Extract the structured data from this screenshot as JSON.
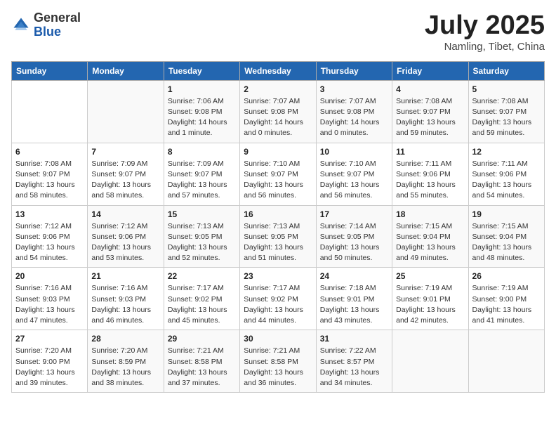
{
  "header": {
    "logo_general": "General",
    "logo_blue": "Blue",
    "month_title": "July 2025",
    "location": "Namling, Tibet, China"
  },
  "weekdays": [
    "Sunday",
    "Monday",
    "Tuesday",
    "Wednesday",
    "Thursday",
    "Friday",
    "Saturday"
  ],
  "weeks": [
    [
      {
        "day": "",
        "info": ""
      },
      {
        "day": "",
        "info": ""
      },
      {
        "day": "1",
        "info": "Sunrise: 7:06 AM\nSunset: 9:08 PM\nDaylight: 14 hours and 1 minute."
      },
      {
        "day": "2",
        "info": "Sunrise: 7:07 AM\nSunset: 9:08 PM\nDaylight: 14 hours and 0 minutes."
      },
      {
        "day": "3",
        "info": "Sunrise: 7:07 AM\nSunset: 9:08 PM\nDaylight: 14 hours and 0 minutes."
      },
      {
        "day": "4",
        "info": "Sunrise: 7:08 AM\nSunset: 9:07 PM\nDaylight: 13 hours and 59 minutes."
      },
      {
        "day": "5",
        "info": "Sunrise: 7:08 AM\nSunset: 9:07 PM\nDaylight: 13 hours and 59 minutes."
      }
    ],
    [
      {
        "day": "6",
        "info": "Sunrise: 7:08 AM\nSunset: 9:07 PM\nDaylight: 13 hours and 58 minutes."
      },
      {
        "day": "7",
        "info": "Sunrise: 7:09 AM\nSunset: 9:07 PM\nDaylight: 13 hours and 58 minutes."
      },
      {
        "day": "8",
        "info": "Sunrise: 7:09 AM\nSunset: 9:07 PM\nDaylight: 13 hours and 57 minutes."
      },
      {
        "day": "9",
        "info": "Sunrise: 7:10 AM\nSunset: 9:07 PM\nDaylight: 13 hours and 56 minutes."
      },
      {
        "day": "10",
        "info": "Sunrise: 7:10 AM\nSunset: 9:07 PM\nDaylight: 13 hours and 56 minutes."
      },
      {
        "day": "11",
        "info": "Sunrise: 7:11 AM\nSunset: 9:06 PM\nDaylight: 13 hours and 55 minutes."
      },
      {
        "day": "12",
        "info": "Sunrise: 7:11 AM\nSunset: 9:06 PM\nDaylight: 13 hours and 54 minutes."
      }
    ],
    [
      {
        "day": "13",
        "info": "Sunrise: 7:12 AM\nSunset: 9:06 PM\nDaylight: 13 hours and 54 minutes."
      },
      {
        "day": "14",
        "info": "Sunrise: 7:12 AM\nSunset: 9:06 PM\nDaylight: 13 hours and 53 minutes."
      },
      {
        "day": "15",
        "info": "Sunrise: 7:13 AM\nSunset: 9:05 PM\nDaylight: 13 hours and 52 minutes."
      },
      {
        "day": "16",
        "info": "Sunrise: 7:13 AM\nSunset: 9:05 PM\nDaylight: 13 hours and 51 minutes."
      },
      {
        "day": "17",
        "info": "Sunrise: 7:14 AM\nSunset: 9:05 PM\nDaylight: 13 hours and 50 minutes."
      },
      {
        "day": "18",
        "info": "Sunrise: 7:15 AM\nSunset: 9:04 PM\nDaylight: 13 hours and 49 minutes."
      },
      {
        "day": "19",
        "info": "Sunrise: 7:15 AM\nSunset: 9:04 PM\nDaylight: 13 hours and 48 minutes."
      }
    ],
    [
      {
        "day": "20",
        "info": "Sunrise: 7:16 AM\nSunset: 9:03 PM\nDaylight: 13 hours and 47 minutes."
      },
      {
        "day": "21",
        "info": "Sunrise: 7:16 AM\nSunset: 9:03 PM\nDaylight: 13 hours and 46 minutes."
      },
      {
        "day": "22",
        "info": "Sunrise: 7:17 AM\nSunset: 9:02 PM\nDaylight: 13 hours and 45 minutes."
      },
      {
        "day": "23",
        "info": "Sunrise: 7:17 AM\nSunset: 9:02 PM\nDaylight: 13 hours and 44 minutes."
      },
      {
        "day": "24",
        "info": "Sunrise: 7:18 AM\nSunset: 9:01 PM\nDaylight: 13 hours and 43 minutes."
      },
      {
        "day": "25",
        "info": "Sunrise: 7:19 AM\nSunset: 9:01 PM\nDaylight: 13 hours and 42 minutes."
      },
      {
        "day": "26",
        "info": "Sunrise: 7:19 AM\nSunset: 9:00 PM\nDaylight: 13 hours and 41 minutes."
      }
    ],
    [
      {
        "day": "27",
        "info": "Sunrise: 7:20 AM\nSunset: 9:00 PM\nDaylight: 13 hours and 39 minutes."
      },
      {
        "day": "28",
        "info": "Sunrise: 7:20 AM\nSunset: 8:59 PM\nDaylight: 13 hours and 38 minutes."
      },
      {
        "day": "29",
        "info": "Sunrise: 7:21 AM\nSunset: 8:58 PM\nDaylight: 13 hours and 37 minutes."
      },
      {
        "day": "30",
        "info": "Sunrise: 7:21 AM\nSunset: 8:58 PM\nDaylight: 13 hours and 36 minutes."
      },
      {
        "day": "31",
        "info": "Sunrise: 7:22 AM\nSunset: 8:57 PM\nDaylight: 13 hours and 34 minutes."
      },
      {
        "day": "",
        "info": ""
      },
      {
        "day": "",
        "info": ""
      }
    ]
  ]
}
